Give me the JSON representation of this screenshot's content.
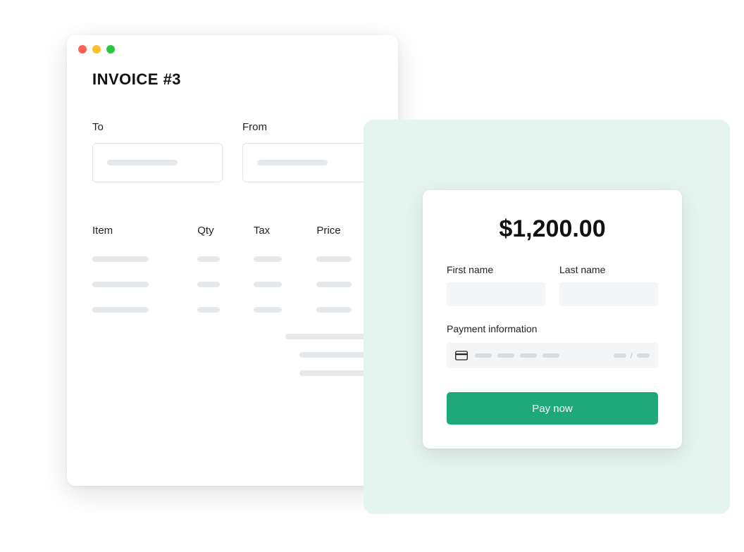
{
  "invoice": {
    "title": "INVOICE #3",
    "to_label": "To",
    "from_label": "From",
    "columns": {
      "item": "Item",
      "qty": "Qty",
      "tax": "Tax",
      "price": "Price"
    }
  },
  "payment": {
    "amount": "$1,200.00",
    "first_name_label": "First name",
    "last_name_label": "Last name",
    "payment_info_label": "Payment information",
    "pay_button": "Pay now"
  }
}
